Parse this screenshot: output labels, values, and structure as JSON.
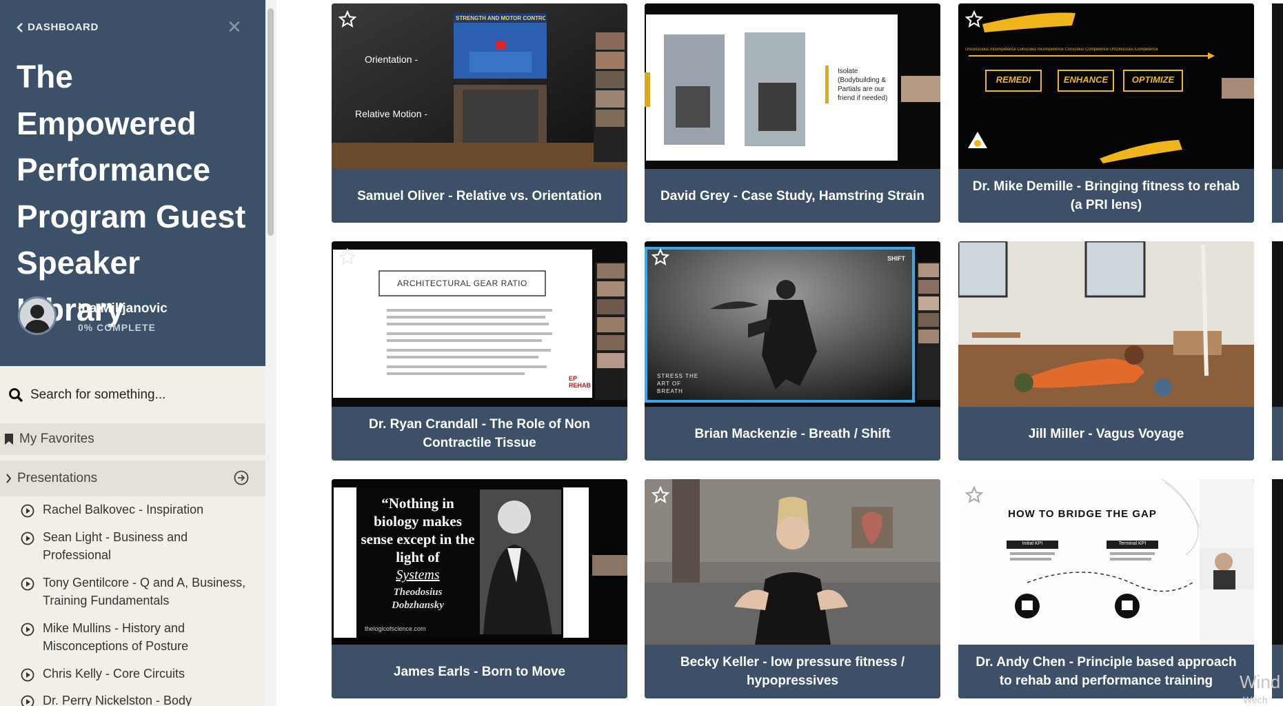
{
  "sidebar": {
    "back_label": "DASHBOARD",
    "course_title": "The Empowered Performance Program Guest Speaker Library",
    "user_name": "Ina Milijanovic",
    "progress": "0% COMPLETE",
    "search_placeholder": "Search for something...",
    "favorites_label": "My Favorites",
    "section_label": "Presentations",
    "lessons": [
      "Rachel Balkovec - Inspiration",
      "Sean Light - Business and Professional",
      "Tony Gentilcore - Q and A, Business, Training Fundamentals",
      "Mike Mullins - History and Misconceptions of Posture",
      "Chris Kelly - Core Circuits",
      "Dr. Perry Nickelston - Body"
    ]
  },
  "cards": [
    {
      "title": "Samuel Oliver - Relative vs. Orientation",
      "slide": {
        "line1": "Orientation -",
        "line2": "Relative Motion -",
        "video_title": "STRENGTH AND MOTOR CONTROL"
      }
    },
    {
      "title": "David Grey - Case Study, Hamstring Strain",
      "slide": {
        "text": "Isolate (Bodybuilding & Partials are our friend if needed)"
      }
    },
    {
      "title": "Dr. Mike Demille - Bringing fitness to rehab (a PRI lens)",
      "slide": {
        "stages": "Unconscious Incompetence    Conscious Incompetence    Conscious Competence    Unconscious Competence",
        "boxes": [
          "REMEDI",
          "ENHANCE",
          "OPTIMIZE"
        ]
      }
    },
    {
      "title": "Dr. Ryan Crandall - The Role of Non Contractile Tissue",
      "slide": {
        "heading": "ARCHITECTURAL GEAR RATIO",
        "logo": "EP REHAB"
      }
    },
    {
      "title": "Brian Mackenzie - Breath / Shift",
      "slide": {
        "overlay": "STRESS THE ART OF BREATH",
        "brand": "SHIFT"
      }
    },
    {
      "title": "Jill Miller - Vagus Voyage"
    },
    {
      "title": "James Earls - Born to Move",
      "slide": {
        "quote": "“Nothing in biology makes sense except in the light of",
        "quote_word": "Systems",
        "author": "Theodosius Dobzhansky",
        "site": "thelogicofscience.com"
      }
    },
    {
      "title": "Becky Keller - low pressure fitness / hypopressives"
    },
    {
      "title": "Dr. Andy Chen - Principle based approach to rehab and performance training",
      "slide": {
        "heading": "HOW TO BRIDGE THE GAP",
        "left": "Initial KPI",
        "right": "Terminal KPI"
      }
    }
  ],
  "watermark": {
    "line1": "Wind",
    "line2": "Wech"
  },
  "colors": {
    "sidebar_header": "#3c5168",
    "caption_bar": "#3e5068",
    "sidebar_body": "#f1efe6"
  }
}
